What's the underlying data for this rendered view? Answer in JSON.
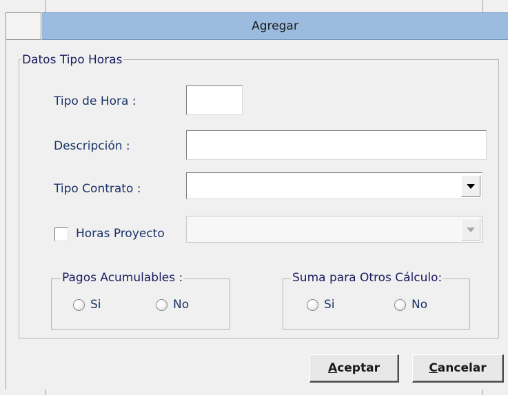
{
  "window": {
    "title": "Agregar"
  },
  "group_main": {
    "label": "Datos Tipo Horas"
  },
  "fields": {
    "tipo_hora": {
      "label": "Tipo de Hora :",
      "value": ""
    },
    "descripcion": {
      "label": "Descripción :",
      "value": ""
    },
    "tipo_contrato": {
      "label": "Tipo Contrato :",
      "value": ""
    },
    "horas_proyecto": {
      "label": "Horas Proyecto",
      "checked": false,
      "value": ""
    }
  },
  "pagos_acumulables": {
    "label": "Pagos Acumulables :",
    "options": [
      {
        "label": "Si",
        "selected": false
      },
      {
        "label": "No",
        "selected": false
      }
    ]
  },
  "suma_otros": {
    "label": "Suma para Otros Cálculo:",
    "options": [
      {
        "label": "Si",
        "selected": false
      },
      {
        "label": "No",
        "selected": false
      }
    ]
  },
  "buttons": {
    "aceptar": {
      "mnemonic": "A",
      "rest": "ceptar"
    },
    "cancelar": {
      "mnemonic": "C",
      "rest": "ancelar"
    }
  },
  "icons": {
    "dropdown": "chevron-down-icon"
  }
}
